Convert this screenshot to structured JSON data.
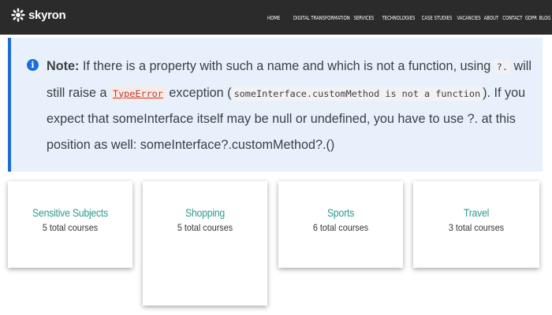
{
  "header": {
    "logo_text": "skyron",
    "nav": [
      "HOME",
      "DIGITAL TRANSFORMATION",
      "SERVICES",
      "TECHNOLOGIES",
      "CASE STUDIES",
      "VACANCIES",
      "ABOUT",
      "CONTACT",
      "GDPR",
      "BLOG"
    ]
  },
  "note": {
    "label": "Note:",
    "t1": " If there is a property with such a name and which is not a function, using ",
    "c1": "?.",
    "t2": " will still raise a ",
    "c2": "TypeError",
    "t3": " exception (",
    "c3": "someInterface.customMethod is not a function",
    "t4": "). If you expect that someInterface itself may be null or undefined, you have to use ?. at this position as well: someInterface?.customMethod?.()"
  },
  "cards": [
    {
      "title": "Sensitive Subjects",
      "count": "5 total courses"
    },
    {
      "title": "Shopping",
      "count": "5 total courses"
    },
    {
      "title": "Sports",
      "count": "6 total courses"
    },
    {
      "title": "Travel",
      "count": "3 total courses"
    }
  ]
}
